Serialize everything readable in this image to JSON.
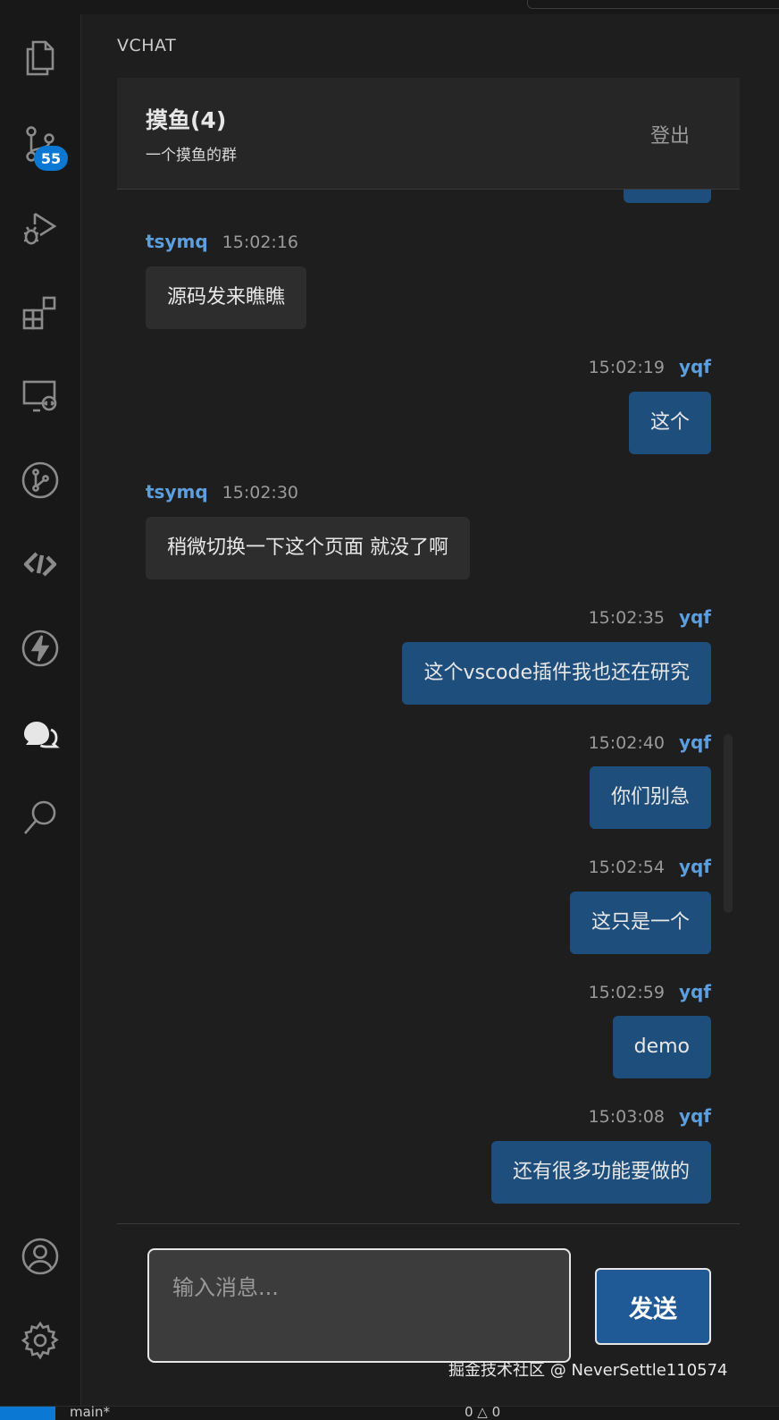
{
  "panel": {
    "title": "VCHAT"
  },
  "activity_bar": {
    "scm_badge": "55",
    "items": [
      "explorer-icon",
      "source-control-icon",
      "run-debug-icon",
      "extensions-icon",
      "remote-explorer-icon",
      "git-graph-icon",
      "live-share-icon",
      "thunder-client-icon",
      "chat-icon",
      "search-icon",
      "account-icon",
      "settings-gear-icon"
    ]
  },
  "group": {
    "name": "摸鱼(4)",
    "description": "一个摸鱼的群",
    "logout_label": "登出"
  },
  "messages": [
    {
      "user": "tsymq",
      "time": "15:02:16",
      "text": "源码发来瞧瞧",
      "self": false
    },
    {
      "user": "yqf",
      "time": "15:02:19",
      "text": "这个",
      "self": true
    },
    {
      "user": "tsymq",
      "time": "15:02:30",
      "text": "稍微切换一下这个页面 就没了啊",
      "self": false
    },
    {
      "user": "yqf",
      "time": "15:02:35",
      "text": "这个vscode插件我也还在研究",
      "self": true
    },
    {
      "user": "yqf",
      "time": "15:02:40",
      "text": "你们别急",
      "self": true
    },
    {
      "user": "yqf",
      "time": "15:02:54",
      "text": "这只是一个",
      "self": true
    },
    {
      "user": "yqf",
      "time": "15:02:59",
      "text": "demo",
      "self": true
    },
    {
      "user": "yqf",
      "time": "15:03:08",
      "text": "还有很多功能要做的",
      "self": true
    }
  ],
  "composer": {
    "placeholder": "输入消息...",
    "send_label": "发送"
  },
  "watermark": "掘金技术社区 @ NeverSettle110574",
  "status_bar": {
    "left_text": "main*",
    "right_text": "0 △ 0"
  },
  "colors": {
    "self_bubble": "#1e4e7c",
    "other_bubble": "#2d2d2d",
    "username": "#5c9ede",
    "badge": "#0b78d4"
  }
}
